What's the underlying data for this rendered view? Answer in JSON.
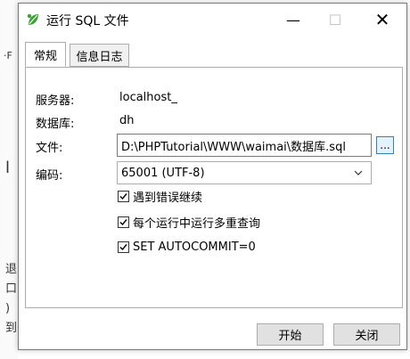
{
  "window": {
    "title": "运行 SQL 文件",
    "icon": "navicat-leaf-icon",
    "controls": {
      "minimize": "—",
      "maximize": "☐",
      "close": "✕"
    }
  },
  "tabs": [
    {
      "label": "常规",
      "active": true
    },
    {
      "label": "信息日志",
      "active": false
    }
  ],
  "form": {
    "server_label": "服务器:",
    "server_value": "localhost_",
    "database_label": "数据库:",
    "database_value": "dh",
    "file_label": "文件:",
    "file_value": "D:\\PHPTutorial\\WWW\\waimai\\数据库.sql",
    "browse_label": "...",
    "encoding_label": "编码:",
    "encoding_value": "65001 (UTF-8)"
  },
  "options": [
    {
      "label": "遇到错误继续",
      "checked": true
    },
    {
      "label": "每个运行中运行多重查询",
      "checked": true
    },
    {
      "label": "SET AUTOCOMMIT=0",
      "checked": true
    }
  ],
  "buttons": {
    "start": "开始",
    "close": "关闭"
  },
  "colors": {
    "accent": "#3c7fb1",
    "icon_green": "#3aa335"
  }
}
